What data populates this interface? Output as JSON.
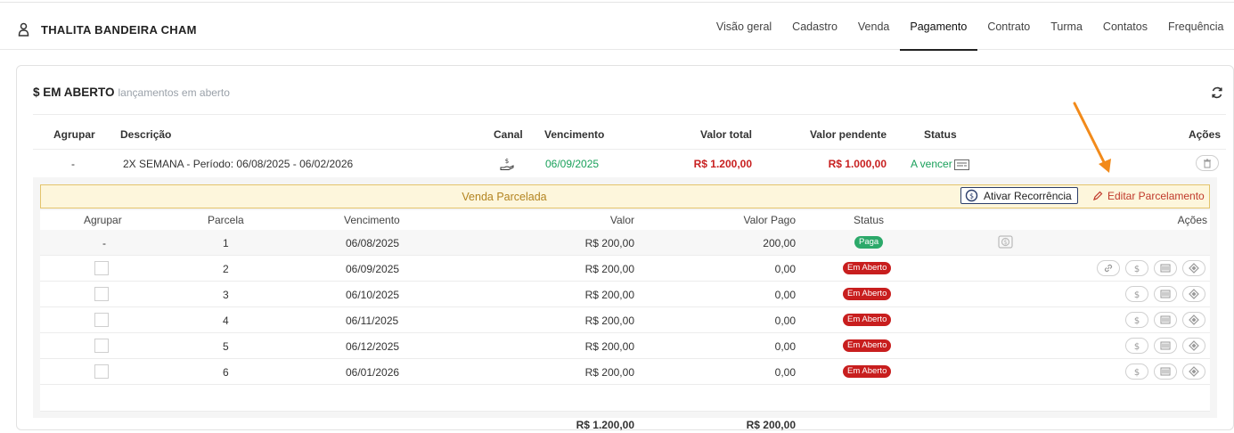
{
  "student": {
    "name": "THALITA BANDEIRA CHAM",
    "icon": "user-icon"
  },
  "tabs": [
    {
      "label": "Visão geral"
    },
    {
      "label": "Cadastro"
    },
    {
      "label": "Venda"
    },
    {
      "label": "Pagamento",
      "active": true
    },
    {
      "label": "Contrato"
    },
    {
      "label": "Turma"
    },
    {
      "label": "Contatos"
    },
    {
      "label": "Frequência"
    }
  ],
  "panel": {
    "title": "$ EM ABERTO",
    "subtitle": "lançamentos em aberto",
    "headers": {
      "agrupar": "Agrupar",
      "descricao": "Descrição",
      "canal": "Canal",
      "vencimento": "Vencimento",
      "valor_total": "Valor total",
      "valor_pendente": "Valor pendente",
      "status": "Status",
      "acoes": "Ações"
    },
    "main_row": {
      "agrupar": "-",
      "descricao": "2X SEMANA - Período: 06/08/2025 - 06/02/2026",
      "vencimento": "06/09/2025",
      "valor_total": "R$ 1.200,00",
      "valor_pendente": "R$ 1.000,00",
      "status": "A vencer"
    }
  },
  "installments": {
    "banner": "Venda Parcelada",
    "btn_recorrencia": "Ativar Recorrência",
    "btn_editar": "Editar Parcelamento",
    "headers": {
      "agrupar": "Agrupar",
      "parcela": "Parcela",
      "vencimento": "Vencimento",
      "valor": "Valor",
      "valor_pago": "Valor Pago",
      "status": "Status",
      "acoes": "Ações"
    },
    "rows": [
      {
        "agrupar": "-",
        "parcela": "1",
        "vencimento": "06/08/2025",
        "valor": "R$ 200,00",
        "valor_pago": "200,00",
        "status": "Paga"
      },
      {
        "parcela": "2",
        "vencimento": "06/09/2025",
        "valor": "R$ 200,00",
        "valor_pago": "0,00",
        "status": "Em Aberto"
      },
      {
        "parcela": "3",
        "vencimento": "06/10/2025",
        "valor": "R$ 200,00",
        "valor_pago": "0,00",
        "status": "Em Aberto"
      },
      {
        "parcela": "4",
        "vencimento": "06/11/2025",
        "valor": "R$ 200,00",
        "valor_pago": "0,00",
        "status": "Em Aberto"
      },
      {
        "parcela": "5",
        "vencimento": "06/12/2025",
        "valor": "R$ 200,00",
        "valor_pago": "0,00",
        "status": "Em Aberto"
      },
      {
        "parcela": "6",
        "vencimento": "06/01/2026",
        "valor": "R$ 200,00",
        "valor_pago": "0,00",
        "status": "Em Aberto"
      }
    ],
    "totals": {
      "valor": "R$ 1.200,00",
      "valor_pago": "R$ 200,00"
    }
  },
  "colors": {
    "accent_green": "#19a05a",
    "accent_red": "#c82020",
    "banner_bg": "#fdf6dc",
    "annotation_arrow": "#f28a1a"
  }
}
